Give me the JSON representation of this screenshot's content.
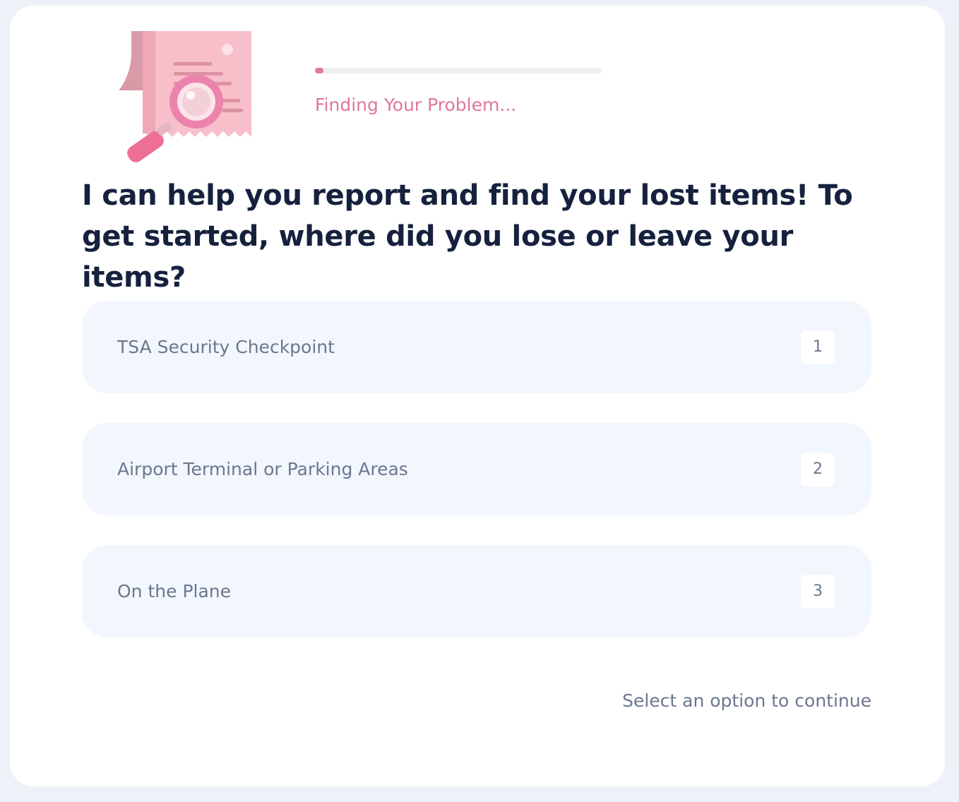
{
  "progress": {
    "fraction": 0.03,
    "status": "Finding Your Problem..."
  },
  "question": "I can help you report and find your lost items! To get started, where did you lose or leave your items?",
  "options": [
    {
      "label": "TSA Security Checkpoint",
      "key": "1"
    },
    {
      "label": "Airport Terminal or Parking Areas",
      "key": "2"
    },
    {
      "label": "On the Plane",
      "key": "3"
    }
  ],
  "hint": "Select an option to continue",
  "colors": {
    "accent": "#e07898",
    "heading": "#15213d",
    "muted": "#6b778e",
    "option_bg": "#f2f6fd",
    "page_bg": "#eef1f8"
  },
  "icons": {
    "illustration": "receipt-magnifier-icon"
  }
}
